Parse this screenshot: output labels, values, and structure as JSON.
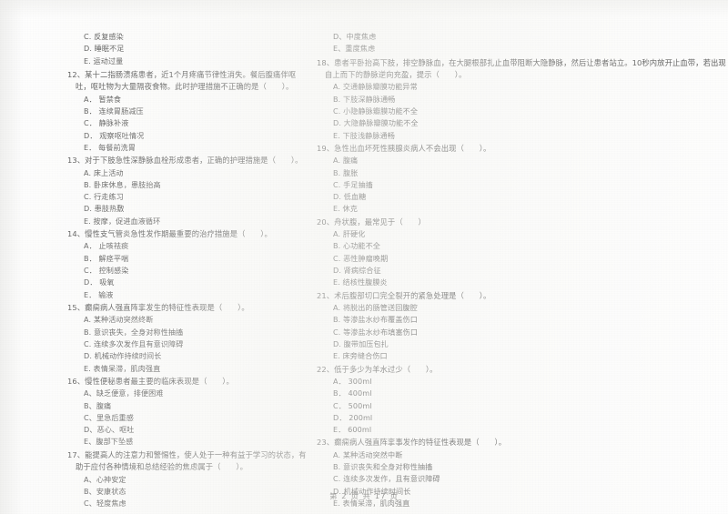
{
  "document": {
    "footer": "第 2 页 共 17 页",
    "page_number": "2",
    "total_pages": "17"
  },
  "left_column": {
    "orphan_options": [
      "C. 反复感染",
      "D. 睡眠不足",
      "E. 运动过量"
    ],
    "questions": [
      {
        "number": "12",
        "stem": "12、某十二指肠溃疡患者，近1个月疼痛节律性消失。餐后腹痛伴呕吐，呕吐物为大量隔夜食物。此时护理措施不正确的是（　　）。",
        "options": [
          "A． 暂禁食",
          "B． 连续胃肠减压",
          "C． 静脉补液",
          "D． 观察呕吐情况",
          "E． 每餐前洗胃"
        ]
      },
      {
        "number": "13",
        "stem": "13、对于下肢急性深静脉血栓形成患者，正确的护理措施是（　　）。",
        "options": [
          "A. 床上活动",
          "B. 卧床休息，患肢抬高",
          "C. 行走练习",
          "D. 患肢热敷",
          "E. 按摩，促进血液循环"
        ]
      },
      {
        "number": "14",
        "stem": "14、慢性支气管炎急性发作期最重要的治疗措施是（　　）。",
        "options": [
          "A． 止咳祛痰",
          "B． 解痉平喘",
          "C． 控制感染",
          "D． 吸氧",
          "E． 输液"
        ]
      },
      {
        "number": "15",
        "stem": "15、癫痫病人强直阵挛发生的特征性表现是（　　）。",
        "options": [
          "A. 某种活动突然终断",
          "B. 意识丧失，全身对称性抽搐",
          "C. 连续多次发作且有意识障碍",
          "D. 机械动作持续时间长",
          "E. 表情呆滞，肌肉强直"
        ]
      },
      {
        "number": "16",
        "stem": "16、慢性便秘患者最主要的临床表现是（　　）。",
        "options": [
          "A、缺乏便意，排便困难",
          "B、腹痛",
          "C、里急后重感",
          "D、恶心、呕吐",
          "E、腹部下坠感"
        ]
      },
      {
        "number": "17",
        "stem": "17、能提高人的注意力和警惕性，使人处于一种有益于学习的状态，有助于应付各种情境和总结经验的焦虑属于（　　）。",
        "options": [
          "A、心神安定",
          "B、安康状态",
          "C、轻度焦虑"
        ]
      }
    ]
  },
  "right_column": {
    "orphan_options": [
      "D、中度焦虑",
      "E、重度焦虑"
    ],
    "questions": [
      {
        "number": "18",
        "stem": "18、患者平卧抬高下肢，排空静脉血，在大腿根部扎止血带阻断大隐静脉，然后让患者站立。10秒内放开止血带，若出现自上而下的静脉逆向充盈，提示（　　）。",
        "options": [
          "A. 交通静脉瓣膜功能异常",
          "B. 下肢深静脉通畅",
          "C. 小隐静脉瓣膜功能不全",
          "D. 大隐静脉瓣膜功能不全",
          "E. 下肢浅静脉通畅"
        ]
      },
      {
        "number": "19",
        "stem": "19、急性出血坏死性胰腺炎病人不会出现（　　）。",
        "options": [
          "A. 腹痛",
          "B. 腹胀",
          "C. 手足抽搐",
          "D. 低血糖",
          "E. 休克"
        ]
      },
      {
        "number": "20",
        "stem": "20、舟状腹，最常见于（　　）",
        "options": [
          "A. 肝硬化",
          "B. 心功能不全",
          "C. 恶性肿瘤晚期",
          "D. 肾病综合征",
          "E. 结核性腹膜炎"
        ]
      },
      {
        "number": "21",
        "stem": "21、术后腹部切口完全裂开的紧急处理是（　　）。",
        "options": [
          "A. 将脱出的肠管送回腹腔",
          "B. 等渗盐水纱布覆盖伤口",
          "C. 等渗盐水纱布填塞伤口",
          "D. 腹带加压包扎",
          "E. 床旁缝合伤口"
        ]
      },
      {
        "number": "22",
        "stem": "22、低于多少为羊水过少（　　）。",
        "options": [
          "A． 300ml",
          "B． 400ml",
          "C． 500ml",
          "D． 200ml",
          "E． 600ml"
        ]
      },
      {
        "number": "23",
        "stem": "23、癫痫病人强直阵挛事发作的特征性表现是（　　）。",
        "options": [
          "A. 某种活动突然中断",
          "B. 意识丧失和全身对称性抽搐",
          "C. 连续多次发作，且有意识障碍",
          "D. 机械动作持续时间长",
          "E. 表情呆滞，肌肉强直"
        ]
      }
    ]
  }
}
